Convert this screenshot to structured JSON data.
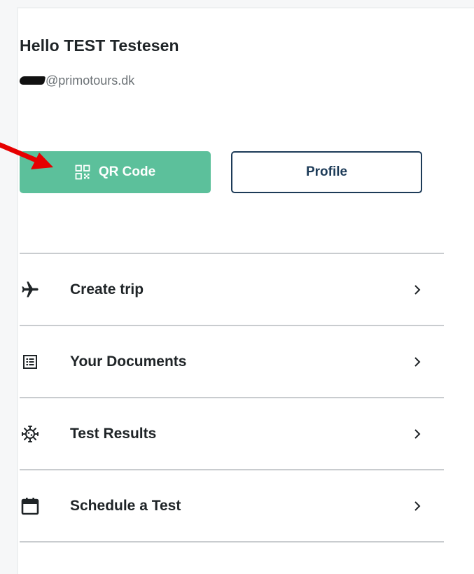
{
  "user": {
    "greeting": "Hello TEST Testesen",
    "email_suffix": "@primotours.dk"
  },
  "actions": {
    "qr_label": "QR Code",
    "profile_label": "Profile"
  },
  "menu": {
    "items": [
      {
        "label": "Create trip",
        "icon": "airplane-icon"
      },
      {
        "label": "Your Documents",
        "icon": "document-list-icon"
      },
      {
        "label": "Test Results",
        "icon": "virus-icon"
      },
      {
        "label": "Schedule a Test",
        "icon": "calendar-icon"
      }
    ]
  },
  "colors": {
    "qr_button_bg": "#5cc09b",
    "profile_border": "#1d3b58",
    "arrow": "#e60000",
    "divider": "#c9cccf"
  }
}
